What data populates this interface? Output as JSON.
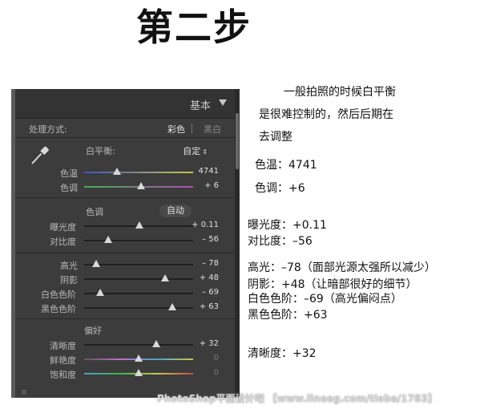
{
  "step_title": "第二步",
  "panel": {
    "title": "基本",
    "process_label": "处理方式:",
    "process_opt_color": "彩色",
    "process_opt_bw": "黑白",
    "wb_label": "白平衡:",
    "wb_value": "自定",
    "temp": {
      "label": "色温",
      "value": "4741",
      "level": 0.3
    },
    "tint": {
      "label": "色调",
      "value": "+ 6",
      "level": 0.52
    },
    "tone_title": "色调",
    "auto_label": "自动",
    "exposure": {
      "label": "曝光度",
      "value": "+ 0.11",
      "level": 0.51
    },
    "contrast": {
      "label": "对比度",
      "value": "– 56",
      "level": 0.22
    },
    "highlights": {
      "label": "高光",
      "value": "– 78",
      "level": 0.11
    },
    "shadows": {
      "label": "阴影",
      "value": "+ 48",
      "level": 0.74
    },
    "whites": {
      "label": "白色色阶",
      "value": "– 69",
      "level": 0.15
    },
    "blacks": {
      "label": "黑色色阶",
      "value": "+ 63",
      "level": 0.81
    },
    "presence_title": "偏好",
    "clarity": {
      "label": "清晰度",
      "value": "+ 32",
      "level": 0.66
    },
    "vibrance": {
      "label": "鲜艳度",
      "value": "0",
      "level": 0.5
    },
    "saturation": {
      "label": "饱和度",
      "value": "0",
      "level": 0.5
    }
  },
  "notes": {
    "intro_1": "一般拍照的时候白平衡",
    "intro_2": "是很难控制的，然后后期在",
    "intro_3": "去调整",
    "temp": "色温：4741",
    "tint": "色调：+6",
    "exposure": "曝光度：+0.11",
    "contrast": "对比度：–56",
    "highlights": "高光：–78（面部光源太强所以减少）",
    "shadows": "阴影：+48（让暗部很好的细节）",
    "whites": "白色色阶：–69（高光偏闷点）",
    "blacks": "黑色色阶：+63",
    "clarity": "清晰度：+32"
  },
  "watermark": "PhotoShop平面设计吧 【www.lineeg.com/tieba/1783】",
  "colors": {
    "panel_bg": "#3c3c3c",
    "panel_text": "#bdbdbd",
    "value_text": "#e0e0e0"
  }
}
